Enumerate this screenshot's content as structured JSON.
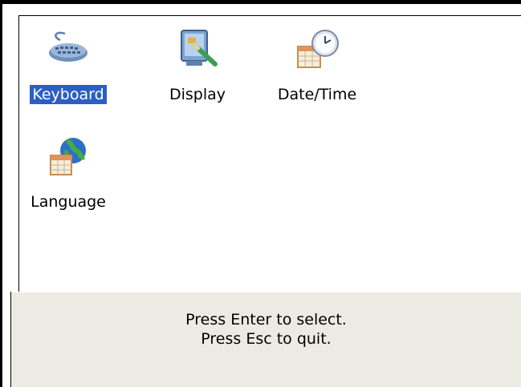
{
  "icons": [
    {
      "label": "Keyboard",
      "icon": "keyboard-icon",
      "selected": true
    },
    {
      "label": "Display",
      "icon": "display-icon",
      "selected": false
    },
    {
      "label": "Date/Time",
      "icon": "clock-icon",
      "selected": false
    },
    {
      "label": "Language",
      "icon": "globe-icon",
      "selected": false
    }
  ],
  "status": {
    "line1": "Press Enter to select.",
    "line2": "Press Esc to quit."
  },
  "colors": {
    "selection": "#2c5fc4",
    "status_bg": "#ecebe3"
  }
}
